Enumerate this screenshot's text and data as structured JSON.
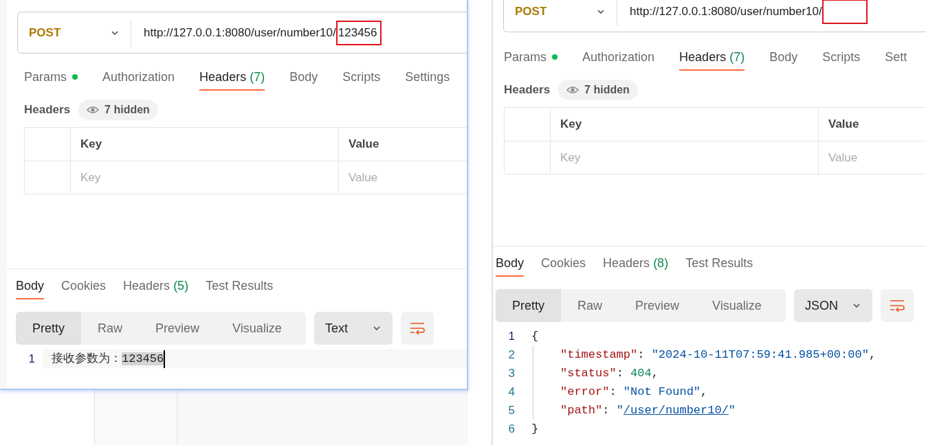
{
  "panels": [
    {
      "method": "POST",
      "url": "http://127.0.0.1:8080/user/number10/",
      "marked": true,
      "marked_text": "123456",
      "request_tabs": [
        {
          "label": "Params",
          "indicator": true,
          "selected": false
        },
        {
          "label": "Authorization",
          "indicator": false,
          "selected": false
        },
        {
          "label": "Headers",
          "count": "(7)",
          "indicator": false,
          "selected": true
        },
        {
          "label": "Body",
          "indicator": false,
          "selected": false
        },
        {
          "label": "Scripts",
          "indicator": false,
          "selected": false
        },
        {
          "label": "Settings",
          "indicator": false,
          "selected": false
        }
      ],
      "headers_title": "Headers",
      "hidden_badge": "7 hidden",
      "table": {
        "columns": [
          "Key",
          "Value"
        ],
        "placeholders": [
          "Key",
          "Value"
        ]
      },
      "response_tabs": [
        {
          "label": "Body",
          "selected": true
        },
        {
          "label": "Cookies",
          "selected": false
        },
        {
          "label": "Headers",
          "count": "(5)",
          "selected": false
        },
        {
          "label": "Test Results",
          "selected": false
        }
      ],
      "view_tabs": [
        {
          "label": "Pretty",
          "selected": true
        },
        {
          "label": "Raw",
          "selected": false
        },
        {
          "label": "Preview",
          "selected": false
        },
        {
          "label": "Visualize",
          "selected": false
        }
      ],
      "format": "Text",
      "lines": [
        {
          "number": "1",
          "current": true,
          "tokens": [
            {
              "kind": "text",
              "text": "接收参数为："
            },
            {
              "kind": "selected",
              "text": "123456"
            }
          ]
        }
      ]
    },
    {
      "method": "POST",
      "url": "http://127.0.0.1:8080/user/number10/",
      "marked": true,
      "request_tabs": [
        {
          "label": "Params",
          "indicator": true,
          "selected": false
        },
        {
          "label": "Authorization",
          "indicator": false,
          "selected": false
        },
        {
          "label": "Headers",
          "count": "(7)",
          "indicator": false,
          "selected": true
        },
        {
          "label": "Body",
          "indicator": false,
          "selected": false
        },
        {
          "label": "Scripts",
          "indicator": false,
          "selected": false
        },
        {
          "label": "Sett",
          "indicator": false,
          "selected": false
        }
      ],
      "headers_title": "Headers",
      "hidden_badge": "7 hidden",
      "table": {
        "columns": [
          "Key",
          "Value"
        ],
        "placeholders": [
          "Key",
          "Value"
        ]
      },
      "response_tabs": [
        {
          "label": "Body",
          "selected": true
        },
        {
          "label": "Cookies",
          "selected": false
        },
        {
          "label": "Headers",
          "count": "(8)",
          "selected": false
        },
        {
          "label": "Test Results",
          "selected": false
        }
      ],
      "view_tabs": [
        {
          "label": "Pretty",
          "selected": true
        },
        {
          "label": "Raw",
          "selected": false
        },
        {
          "label": "Preview",
          "selected": false
        },
        {
          "label": "Visualize",
          "selected": false
        }
      ],
      "format": "JSON",
      "lines": [
        {
          "number": "1",
          "current": true,
          "tokens": [
            {
              "kind": "punct",
              "text": "{"
            }
          ],
          "children": [
            {
              "number": "2",
              "current": false,
              "tokens": [
                {
                  "kind": "key",
                  "text": "\"timestamp\""
                },
                {
                  "kind": "punct",
                  "text": ": "
                },
                {
                  "kind": "string",
                  "text": "\"2024-10-11T07:59:41.985+00:00\""
                },
                {
                  "kind": "punct",
                  "text": ","
                }
              ]
            },
            {
              "number": "3",
              "current": false,
              "tokens": [
                {
                  "kind": "key",
                  "text": "\"status\""
                },
                {
                  "kind": "punct",
                  "text": ": "
                },
                {
                  "kind": "number",
                  "text": "404"
                },
                {
                  "kind": "punct",
                  "text": ","
                }
              ]
            },
            {
              "number": "4",
              "current": false,
              "tokens": [
                {
                  "kind": "key",
                  "text": "\"error\""
                },
                {
                  "kind": "punct",
                  "text": ": "
                },
                {
                  "kind": "string",
                  "text": "\"Not Found\""
                },
                {
                  "kind": "punct",
                  "text": ","
                }
              ]
            },
            {
              "number": "5",
              "current": false,
              "tokens": [
                {
                  "kind": "key",
                  "text": "\"path\""
                },
                {
                  "kind": "punct",
                  "text": ": "
                },
                {
                  "kind": "string",
                  "text": "\""
                },
                {
                  "kind": "link",
                  "text": "/user/number10/"
                },
                {
                  "kind": "string",
                  "text": "\""
                }
              ]
            }
          ]
        },
        {
          "number": "6",
          "current": false,
          "tokens": [
            {
              "kind": "punct",
              "text": "}"
            }
          ]
        }
      ]
    }
  ]
}
